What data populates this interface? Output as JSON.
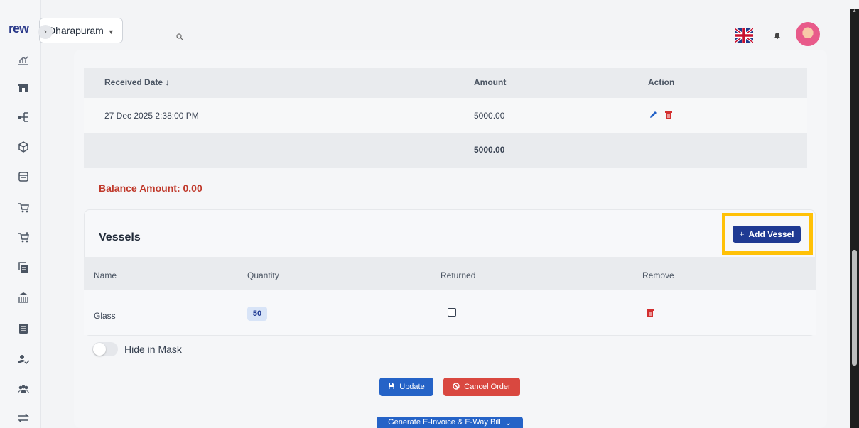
{
  "brand": {
    "logo_text": "rew"
  },
  "topbar": {
    "branch": "Dharapuram",
    "search_icon": "search-icon",
    "flag_icon": "uk-flag-icon",
    "bell_icon": "bell-icon"
  },
  "sidebar": {
    "items": [
      {
        "name": "analytics",
        "icon": "chart-bars-icon"
      },
      {
        "name": "store",
        "icon": "store-icon"
      },
      {
        "name": "hierarchy",
        "icon": "hierarchy-icon"
      },
      {
        "name": "package",
        "icon": "cube-icon"
      },
      {
        "name": "orders",
        "icon": "archive-box-icon"
      },
      {
        "name": "cart",
        "icon": "cart-icon"
      },
      {
        "name": "cart-add",
        "icon": "cart-plus-icon"
      },
      {
        "name": "copy",
        "icon": "copy-icon"
      },
      {
        "name": "shop",
        "icon": "shop-icon"
      },
      {
        "name": "list",
        "icon": "list-icon"
      },
      {
        "name": "user-check",
        "icon": "user-check-icon"
      },
      {
        "name": "team",
        "icon": "users-icon"
      },
      {
        "name": "transfer",
        "icon": "transfer-icon"
      }
    ]
  },
  "payments": {
    "headers": {
      "date": "Received Date ↓",
      "amount": "Amount",
      "action": "Action"
    },
    "rows": [
      {
        "date": "27 Dec 2025 2:38:00 PM",
        "amount": "5000.00"
      }
    ],
    "total": "5000.00"
  },
  "balance": "Balance Amount: 0.00",
  "vessels": {
    "title": "Vessels",
    "add_label": "Add Vessel",
    "headers": {
      "name": "Name",
      "quantity": "Quantity",
      "returned": "Returned",
      "remove": "Remove"
    },
    "rows": [
      {
        "name": "Glass",
        "quantity": "50",
        "returned": false
      }
    ]
  },
  "hide_in_mask": {
    "label": "Hide in Mask",
    "on": false
  },
  "actions": {
    "update": "Update",
    "cancel": "Cancel Order",
    "einvoice": "Generate E-Invoice & E-Way Bill"
  },
  "colors": {
    "primary": "#1f3a93",
    "update": "#2563c7",
    "danger": "#d94840",
    "balance_text": "#c0392b",
    "highlight": "#ffc107"
  }
}
